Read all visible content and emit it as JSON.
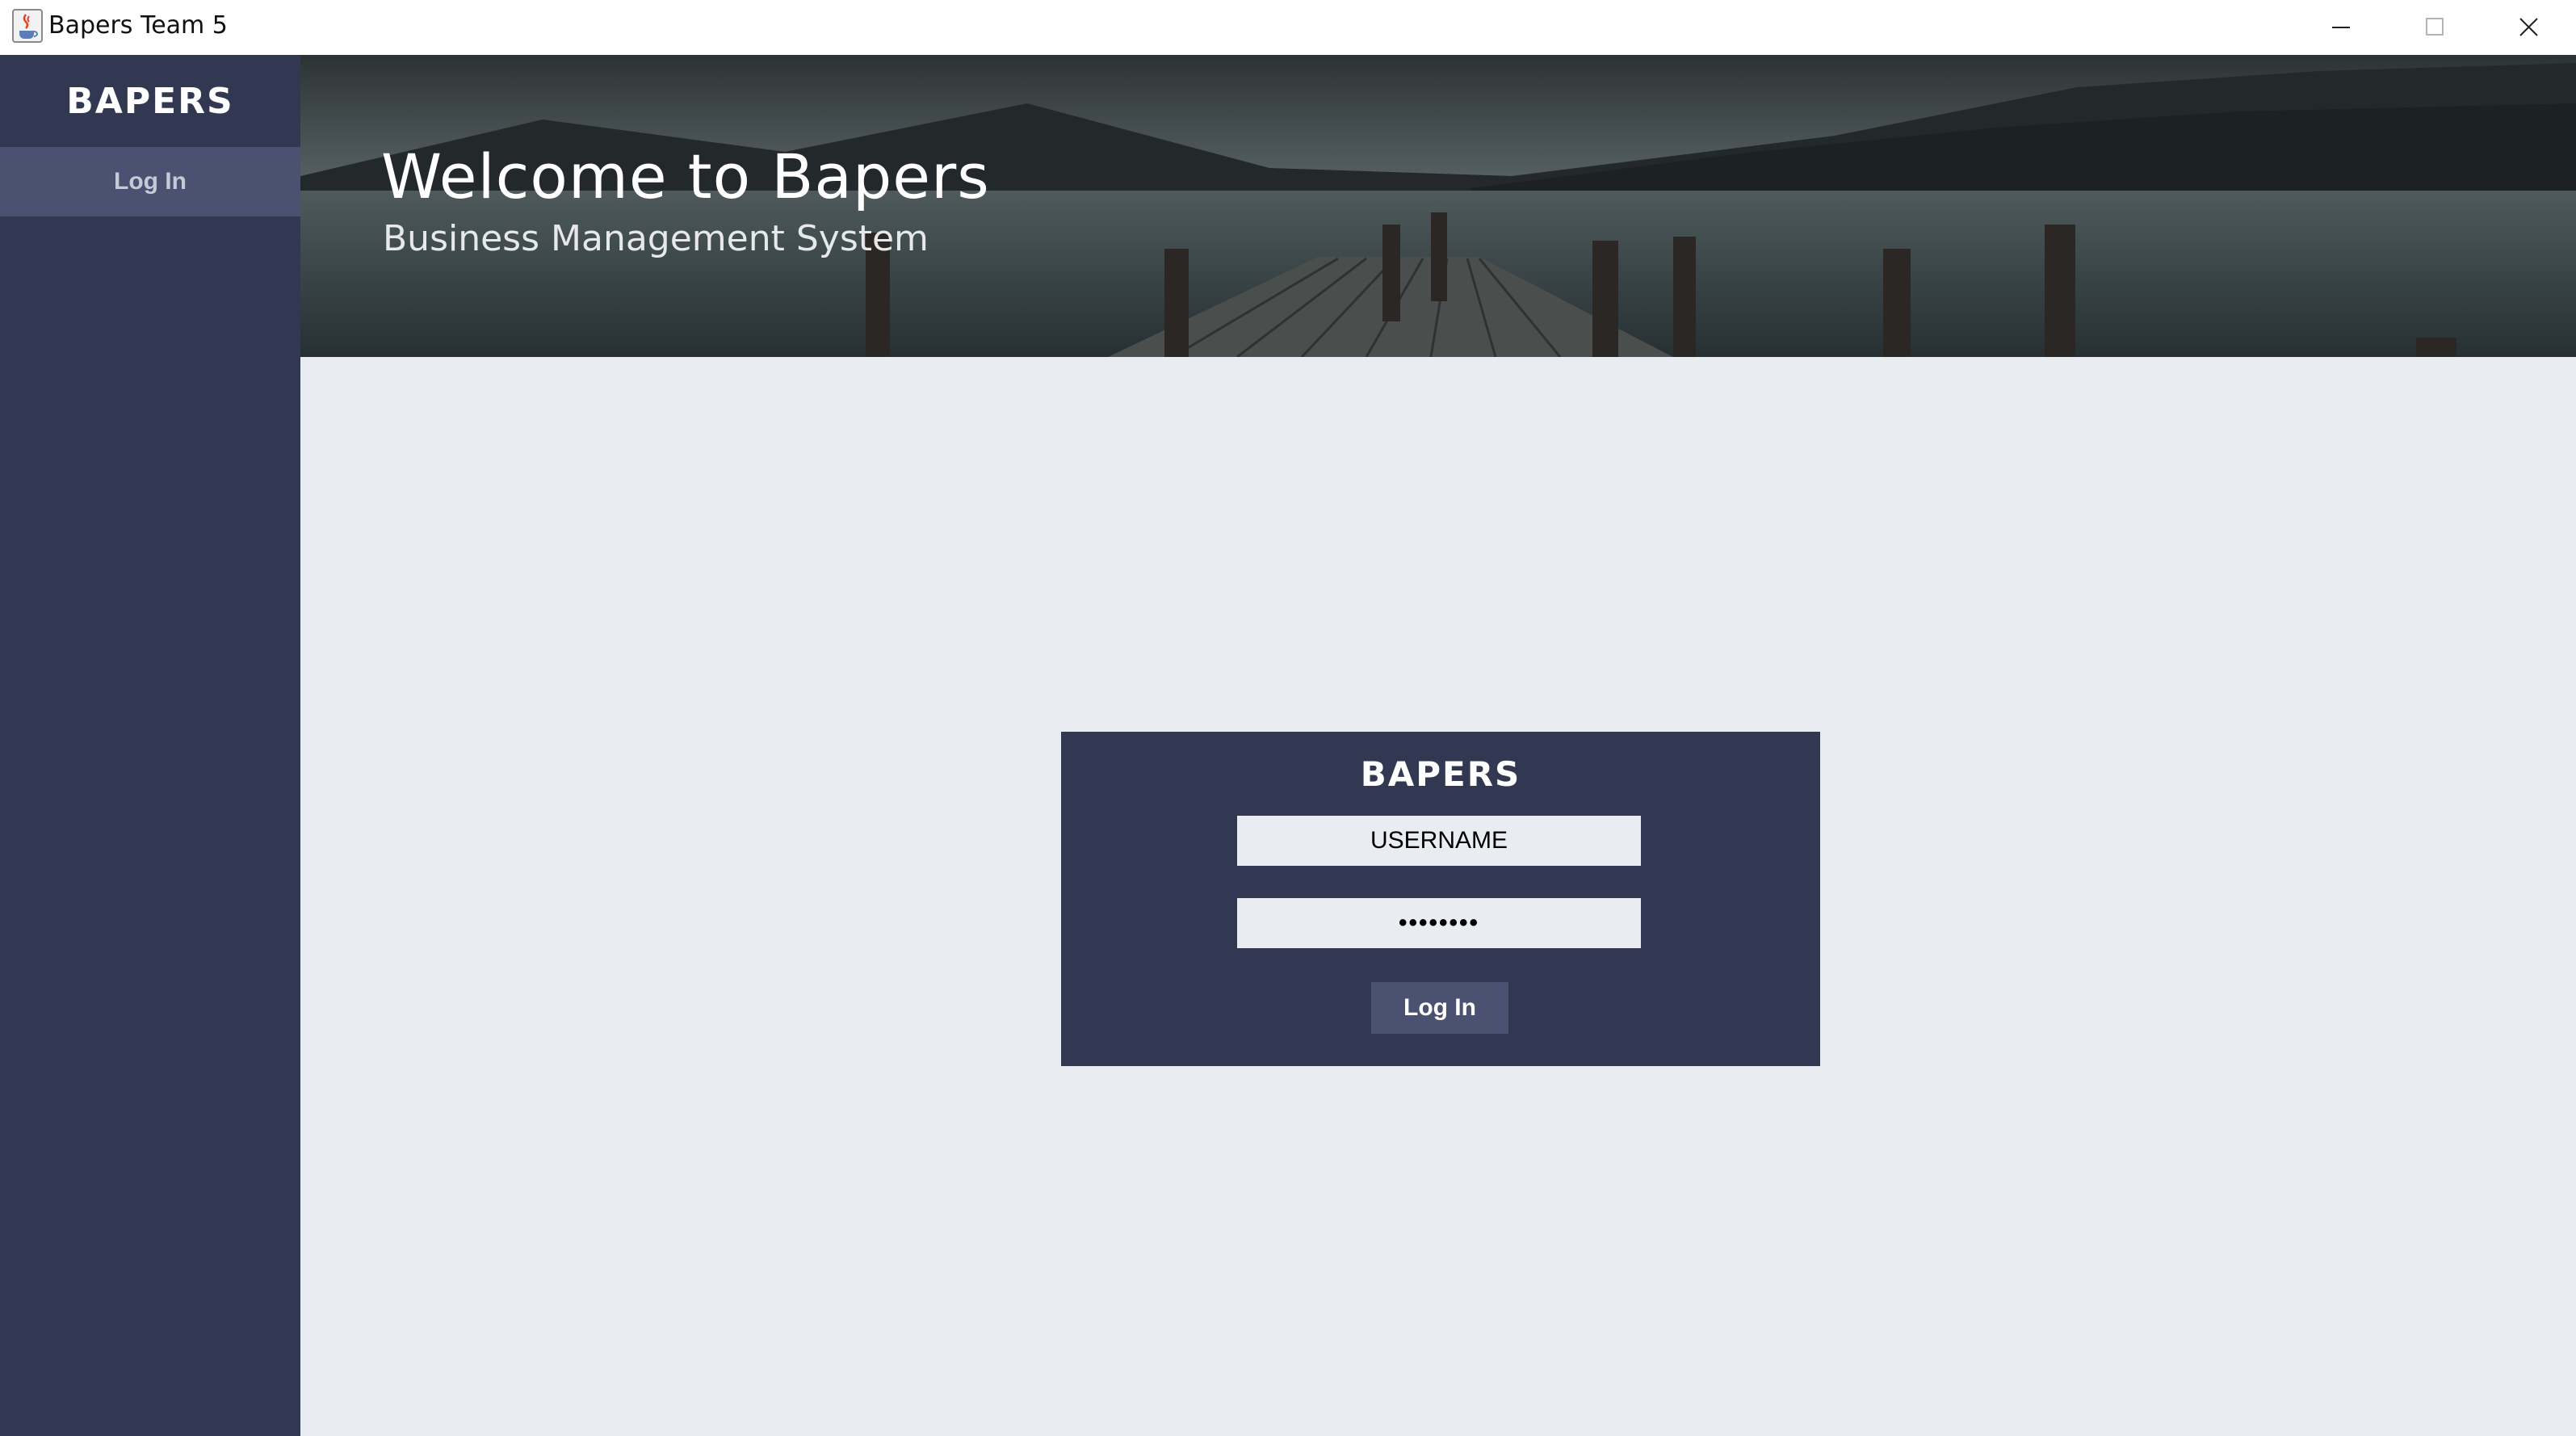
{
  "window": {
    "title": "Bapers Team 5",
    "icon": "java-cup-icon",
    "controls": [
      "minimize-icon",
      "maximize-icon",
      "close-icon"
    ]
  },
  "sidebar": {
    "brand": "BAPERS",
    "items": [
      {
        "label": "Log In"
      }
    ]
  },
  "banner": {
    "title": "Welcome to Bapers",
    "subtitle": "Business Management System"
  },
  "login": {
    "brand": "BAPERS",
    "username_value": "USERNAME",
    "password_value": "••••••••",
    "button_label": "Log In"
  },
  "colors": {
    "sidebar": "#323851",
    "sidebar_active": "#4b5170",
    "panel": "#323851",
    "background": "#e9ecf1"
  }
}
